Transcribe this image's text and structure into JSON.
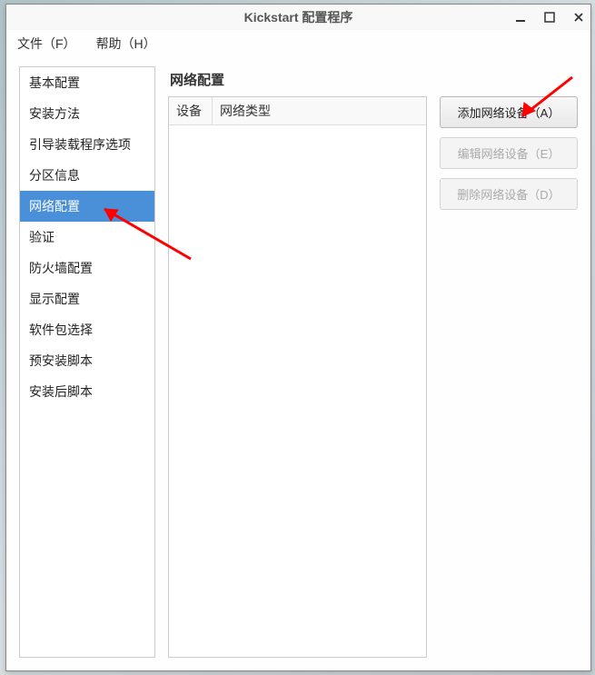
{
  "window": {
    "title": "Kickstart 配置程序"
  },
  "menu": {
    "file": "文件（F）",
    "help": "帮助（H）"
  },
  "sidebar": {
    "items": [
      {
        "label": "基本配置"
      },
      {
        "label": "安装方法"
      },
      {
        "label": "引导装载程序选项"
      },
      {
        "label": "分区信息"
      },
      {
        "label": "网络配置"
      },
      {
        "label": "验证"
      },
      {
        "label": "防火墙配置"
      },
      {
        "label": "显示配置"
      },
      {
        "label": "软件包选择"
      },
      {
        "label": "预安装脚本"
      },
      {
        "label": "安装后脚本"
      }
    ],
    "selected_index": 4
  },
  "main": {
    "heading": "网络配置",
    "columns": {
      "device": "设备",
      "net_type": "网络类型"
    },
    "buttons": {
      "add": "添加网络设备（A）",
      "edit": "编辑网络设备（E）",
      "delete": "删除网络设备（D）"
    }
  }
}
